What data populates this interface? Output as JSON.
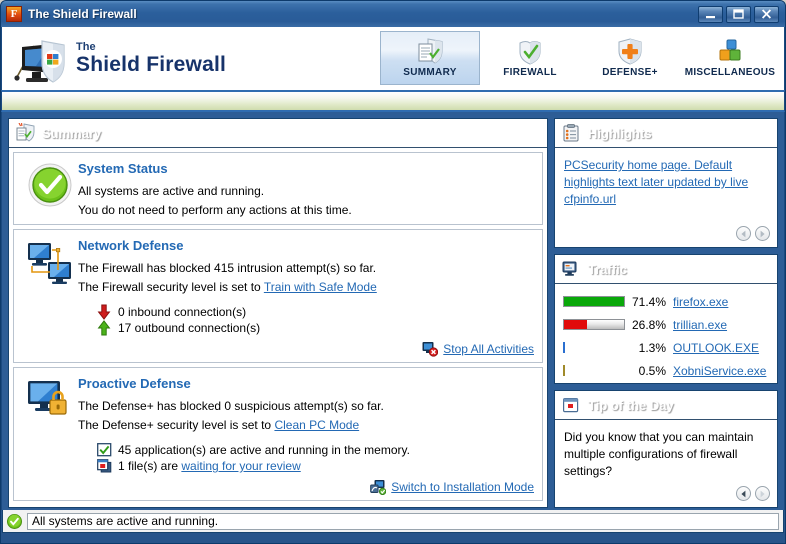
{
  "window": {
    "title": "The Shield Firewall",
    "icon": "shield-f-icon",
    "buttons": {
      "minimize": "minimize-icon",
      "maximize": "maximize-icon",
      "close": "close-icon"
    }
  },
  "brand": {
    "line1": "The",
    "line2": "Shield Firewall",
    "logo": "monitor-shield-logo"
  },
  "tabs": [
    {
      "label": "SUMMARY",
      "icon": "shield-document-icon",
      "active": true
    },
    {
      "label": "FIREWALL",
      "icon": "shield-check-icon",
      "active": false
    },
    {
      "label": "DEFENSE+",
      "icon": "shield-plus-icon",
      "active": false
    },
    {
      "label": "MISCELLANEOUS",
      "icon": "colored-blocks-icon",
      "active": false
    }
  ],
  "summary": {
    "header": {
      "title": "Summary",
      "icon": "shield-document-icon"
    },
    "system_status": {
      "icon": "green-check-circle-icon",
      "title": "System Status",
      "line1": "All systems are active and running.",
      "line2": "You do not need to perform any actions at this time."
    },
    "network_defense": {
      "icon": "two-monitors-icon",
      "title": "Network Defense",
      "line1": "The Firewall has blocked 415 intrusion attempt(s) so far.",
      "line2_prefix": "The Firewall security level is set to ",
      "line2_link": "Train with Safe Mode",
      "inbound": {
        "icon": "red-down-arrow-icon",
        "text": "0 inbound connection(s)"
      },
      "outbound": {
        "icon": "green-up-arrow-icon",
        "text": "17 outbound connection(s)"
      },
      "action": {
        "icon": "stop-activities-icon",
        "label": "Stop All Activities"
      }
    },
    "proactive_defense": {
      "icon": "monitor-lock-icon",
      "title": "Proactive Defense",
      "line1": "The Defense+ has blocked 0 suspicious attempt(s) so far.",
      "line2_prefix": "The Defense+ security level is set to ",
      "line2_link": "Clean PC Mode",
      "apps": {
        "icon": "green-check-box-icon",
        "text": "45 application(s) are active and running in the memory."
      },
      "files": {
        "icon": "pending-files-icon",
        "text_prefix": "1 file(s) are ",
        "link": "waiting for your review"
      },
      "action": {
        "icon": "installation-mode-icon",
        "label": "Switch to Installation Mode"
      }
    }
  },
  "highlights": {
    "header": {
      "title": "Highlights",
      "icon": "clipboard-icon"
    },
    "text": "PCSecurity home page. Default highlights text later updated by live cfpinfo.url",
    "pager": {
      "prev": "prev-arrow-icon",
      "next": "next-arrow-icon",
      "prev_enabled": false,
      "next_enabled": false
    }
  },
  "traffic": {
    "header": {
      "title": "Traffic",
      "icon": "monitor-traffic-icon"
    },
    "rows": [
      {
        "percent": "71.4%",
        "name": "firefox.exe",
        "bar_pct": 100,
        "color": "#0aa80a"
      },
      {
        "percent": "26.8%",
        "name": "trillian.exe",
        "bar_pct": 38,
        "color": "#e10b0b"
      },
      {
        "percent": "1.3%",
        "name": "OUTLOOK.EXE",
        "bar_pct": 2,
        "color": "#2a6fd0"
      },
      {
        "percent": "0.5%",
        "name": "XobniService.exe",
        "bar_pct": 2,
        "color": "#a08a2a"
      }
    ]
  },
  "tip": {
    "header": {
      "title": "Tip of the Day",
      "icon": "tip-window-icon"
    },
    "text": "Did you know that you can maintain multiple configurations of firewall settings?",
    "pager": {
      "prev": "prev-arrow-icon",
      "next": "next-arrow-icon",
      "prev_enabled": true,
      "next_enabled": false
    }
  },
  "status_bar": {
    "icon": "green-check-circle-icon",
    "text": "All systems are active and running."
  },
  "colors": {
    "title_bar": "#2d5d96",
    "panel_header": "#4d6583",
    "link": "#2369b4",
    "section_title": "#2369b4",
    "green_ok": "#5cb811",
    "traffic_green": "#0aa80a",
    "traffic_red": "#e10b0b"
  }
}
